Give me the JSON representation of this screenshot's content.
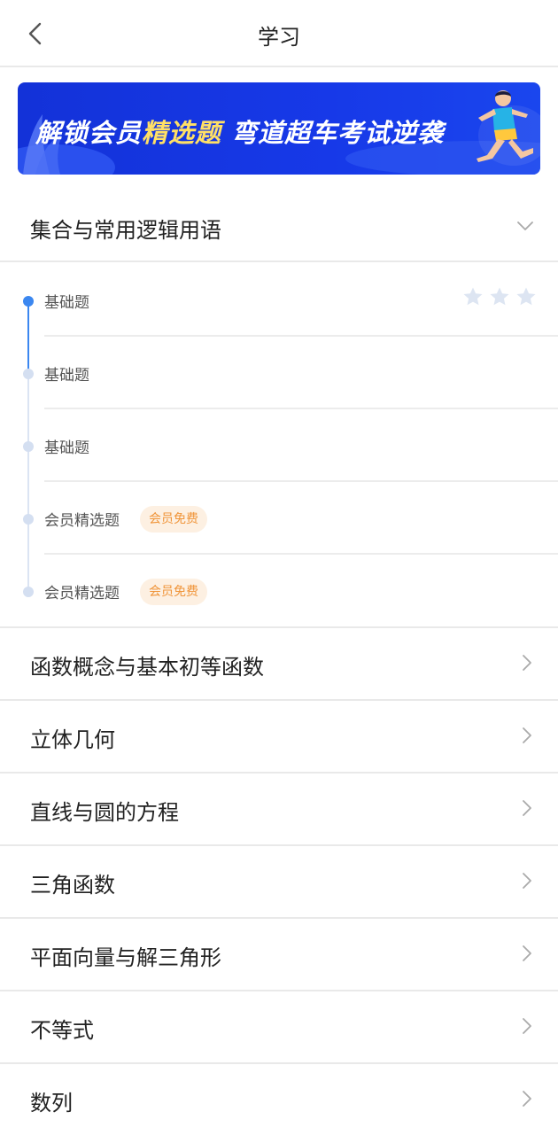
{
  "header": {
    "title": "学习",
    "back_icon": "chevron-left-icon"
  },
  "banner": {
    "part1": "解锁会员",
    "part2": "精选题",
    "part3": " 弯道超车考试逆袭",
    "colors": {
      "background": "#1739e8",
      "highlight": "#ffe066"
    }
  },
  "section": {
    "title": "集合与常用逻辑用语",
    "icon": "chevron-down-icon",
    "items": [
      {
        "label": "基础题",
        "active": true,
        "stars": 3
      },
      {
        "label": "基础题"
      },
      {
        "label": "基础题"
      },
      {
        "label": "会员精选题",
        "badge": "会员免费"
      },
      {
        "label": "会员精选题",
        "badge": "会员免费"
      }
    ]
  },
  "chapters": [
    {
      "title": "函数概念与基本初等函数"
    },
    {
      "title": "立体几何"
    },
    {
      "title": "直线与圆的方程"
    },
    {
      "title": "三角函数"
    },
    {
      "title": "平面向量与解三角形"
    },
    {
      "title": "不等式"
    },
    {
      "title": "数列"
    }
  ],
  "colors": {
    "accent": "#3b87f0",
    "badge_text": "#f0953a",
    "badge_bg": "#fdf0e2"
  }
}
